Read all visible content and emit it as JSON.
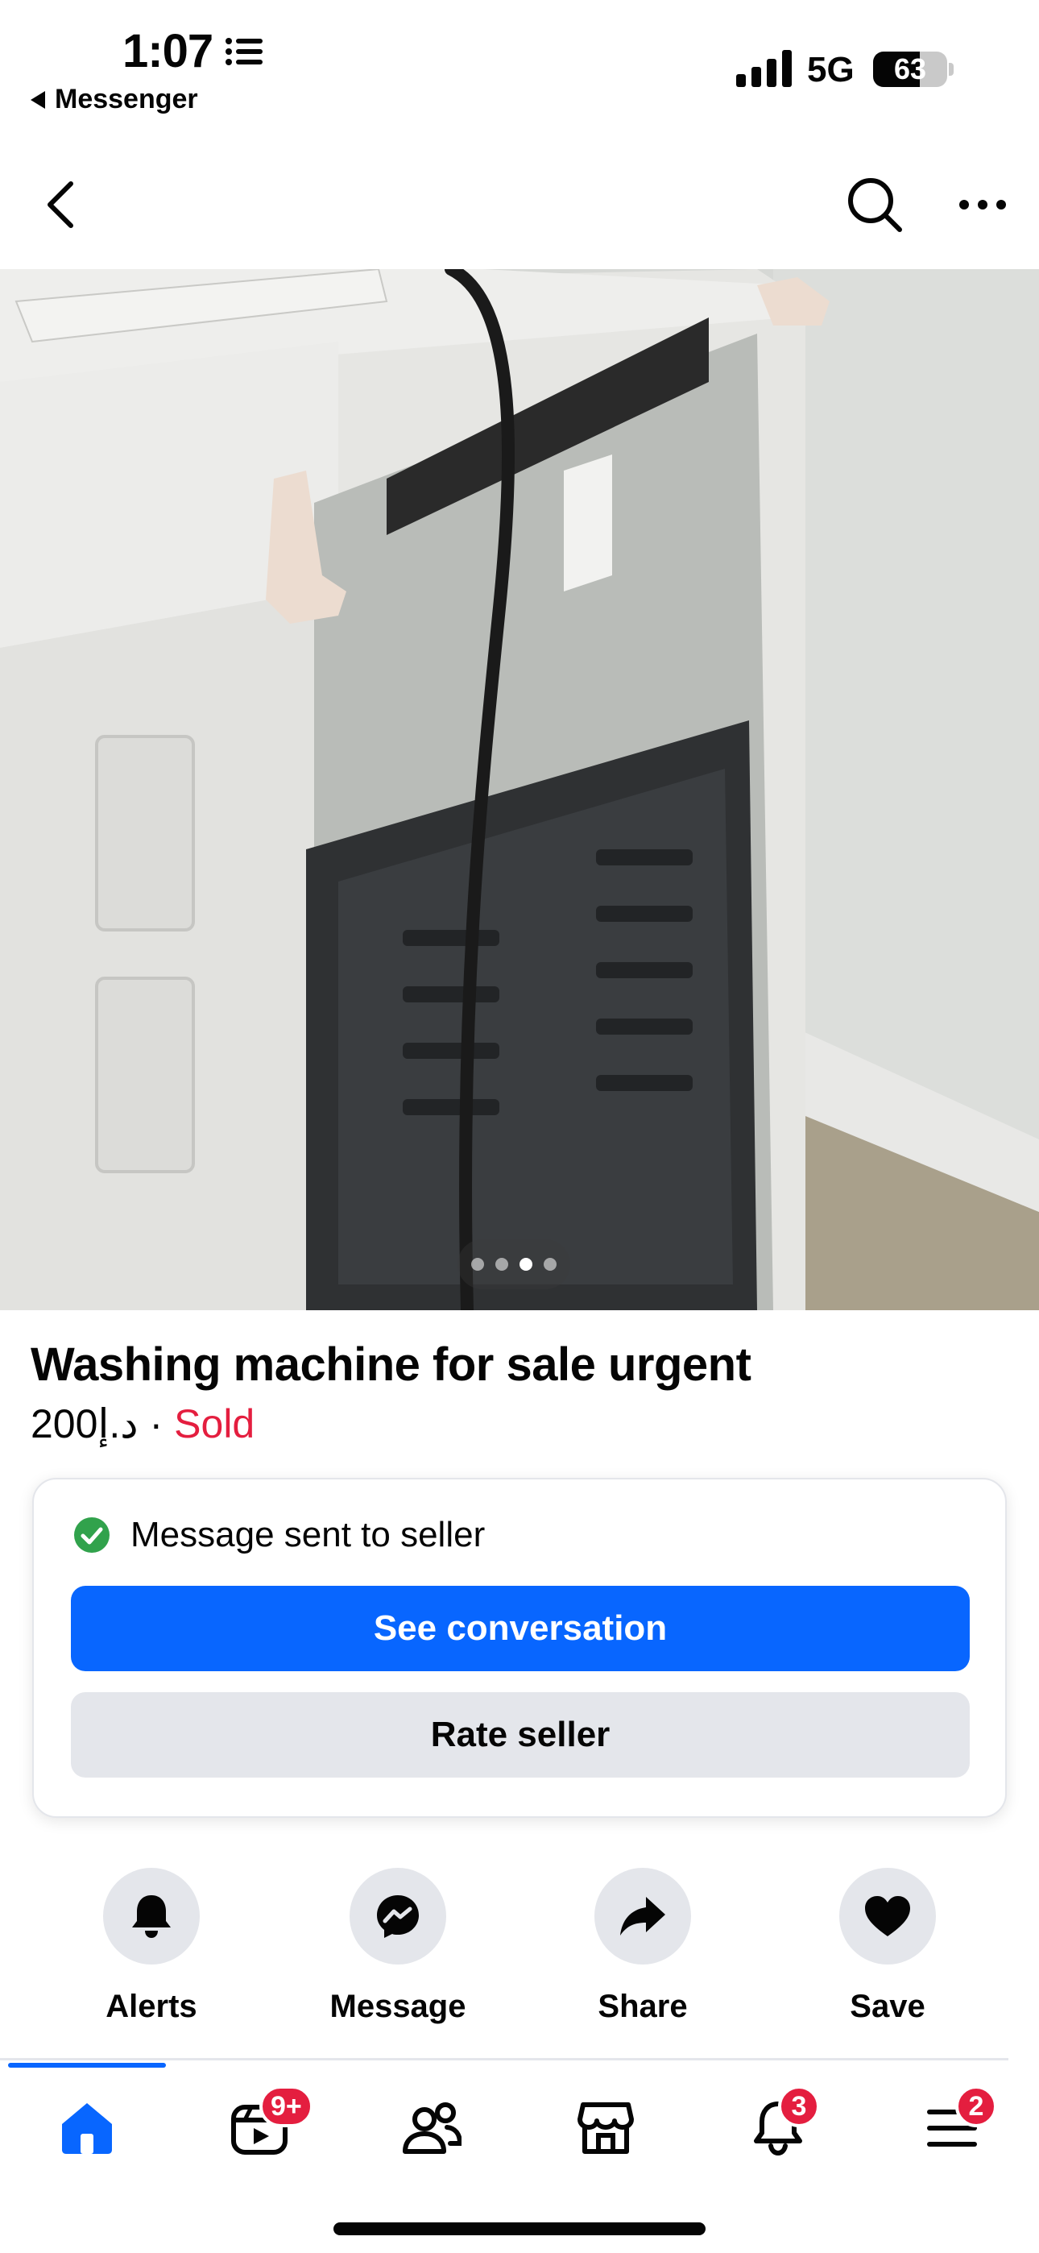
{
  "status_bar": {
    "time": "1:07",
    "back_app": "Messenger",
    "network": "5G",
    "battery_level": "63",
    "battery_fraction": 0.63
  },
  "nav": {
    "back_icon": "chevron-left-icon",
    "search_icon": "search-icon",
    "more_icon": "more-icon"
  },
  "photo": {
    "dots_total": 4,
    "active_index": 2
  },
  "listing": {
    "title": "Washing machine for sale urgent",
    "price": "200د.إ",
    "separator": "·",
    "status": "Sold"
  },
  "card": {
    "status_text": "Message sent to seller",
    "primary_button": "See conversation",
    "secondary_button": "Rate seller"
  },
  "actions": [
    {
      "label": "Alerts",
      "icon": "bell-icon"
    },
    {
      "label": "Message",
      "icon": "messenger-icon"
    },
    {
      "label": "Share",
      "icon": "share-icon"
    },
    {
      "label": "Save",
      "icon": "heart-icon"
    }
  ],
  "tabs": [
    {
      "name": "home",
      "icon": "home-icon",
      "badge": ""
    },
    {
      "name": "video",
      "icon": "video-icon",
      "badge": "9+"
    },
    {
      "name": "friends",
      "icon": "friends-icon",
      "badge": ""
    },
    {
      "name": "marketplace",
      "icon": "marketplace-icon",
      "badge": ""
    },
    {
      "name": "notifications",
      "icon": "bell-icon",
      "badge": "3"
    },
    {
      "name": "menu",
      "icon": "menu-icon",
      "badge": "2"
    }
  ],
  "colors": {
    "accent": "#0866ff",
    "sold": "#e41e3f",
    "button_secondary": "#e4e6eb",
    "success": "#31a24c"
  }
}
